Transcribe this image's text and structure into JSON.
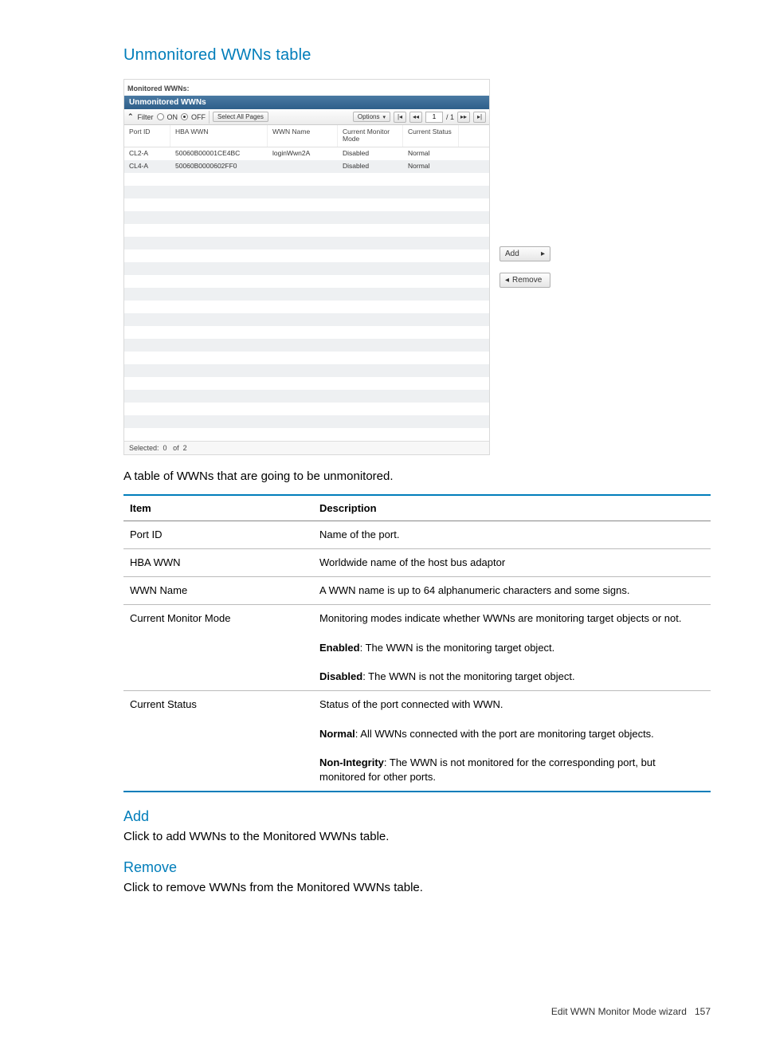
{
  "headings": {
    "main": "Unmonitored WWNs table",
    "add": "Add",
    "remove": "Remove"
  },
  "body": {
    "intro": "A table of WWNs that are going to be unmonitored.",
    "add_desc": "Click to add WWNs to the Monitored WWNs table.",
    "remove_desc": "Click to remove WWNs from the Monitored WWNs table."
  },
  "panel": {
    "outer_label": "Monitored WWNs:",
    "title": "Unmonitored WWNs",
    "toolbar": {
      "filter": "Filter",
      "on": "ON",
      "off": "OFF",
      "select_all": "Select All Pages",
      "options": "Options",
      "page": "1",
      "page_total": "/ 1"
    },
    "columns": {
      "port": "Port ID",
      "hba": "HBA WWN",
      "wwn": "WWN Name",
      "mode": "Current Monitor Mode",
      "status": "Current Status"
    },
    "rows": [
      {
        "port": "CL2-A",
        "hba": "50060B00001CE4BC",
        "wwn": "loginWwn2A",
        "mode": "Disabled",
        "status": "Normal"
      },
      {
        "port": "CL4-A",
        "hba": "50060B0000602FF0",
        "wwn": "",
        "mode": "Disabled",
        "status": "Normal"
      }
    ],
    "footer": {
      "selected_label": "Selected:",
      "selected_count": "0",
      "of_label": "of",
      "total": "2"
    },
    "side_add": "Add",
    "side_remove": "Remove"
  },
  "desc_table": {
    "head_item": "Item",
    "head_desc": "Description",
    "rows": {
      "portid": {
        "item": "Port ID",
        "desc": "Name of the port."
      },
      "hba": {
        "item": "HBA WWN",
        "desc": "Worldwide name of the host bus adaptor"
      },
      "wwn": {
        "item": "WWN Name",
        "desc": "A WWN name is up to 64 alphanumeric characters and some signs."
      },
      "mode": {
        "item": "Current Monitor Mode",
        "line1": "Monitoring modes indicate whether WWNs are monitoring target objects or not.",
        "enabled_label": "Enabled",
        "enabled_text": ": The WWN is the monitoring target object.",
        "disabled_label": "Disabled",
        "disabled_text": ": The WWN is not the monitoring target object."
      },
      "status": {
        "item": "Current Status",
        "line1": "Status of the port connected with WWN.",
        "normal_label": "Normal",
        "normal_text": ": All WWNs connected with the port are monitoring target objects.",
        "nonint_label": "Non-Integrity",
        "nonint_text": ": The WWN is not monitored for the corresponding port, but monitored for other ports."
      }
    }
  },
  "footer": {
    "text": "Edit WWN Monitor Mode wizard",
    "page_num": "157"
  }
}
